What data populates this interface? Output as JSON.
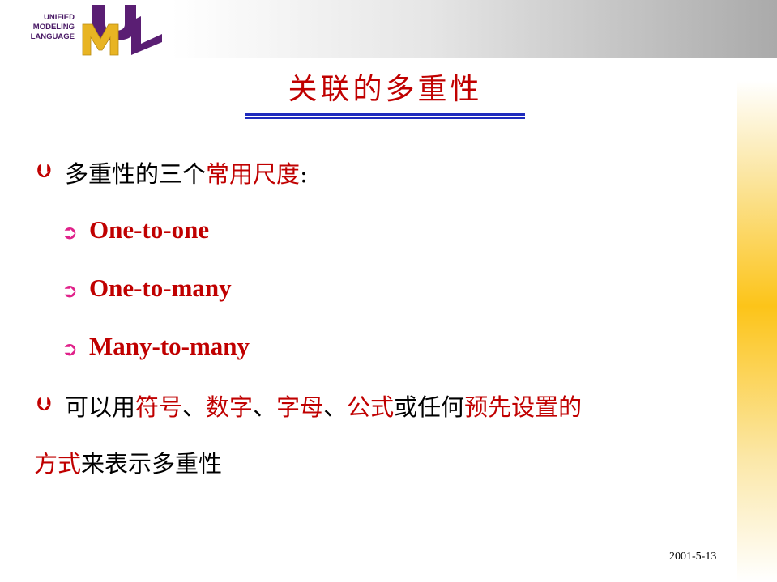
{
  "logo": {
    "line1": "UNIFIED",
    "line2": "MODELING",
    "line3": "LANGUAGE",
    "colors": {
      "u": "#5a1e73",
      "m": "#e8b423",
      "l": "#5a1e73"
    }
  },
  "title": "关联的多重性",
  "bullets": [
    {
      "parts": [
        "多重性的三个",
        "常用尺度",
        ":"
      ],
      "sub": [
        "One-to-one",
        "One-to-many",
        "Many-to-many"
      ]
    },
    {
      "line1": [
        "可以用",
        "符号",
        "、",
        "数字",
        "、",
        "字母",
        "、",
        "公式",
        "或任何",
        "预先设置的"
      ],
      "line2": [
        "方式",
        "来表示多重性"
      ]
    }
  ],
  "footer": {
    "date": "2001-5-13"
  },
  "colors": {
    "accent_red": "#c00000",
    "rule_blue": "#1f2bbd",
    "sub_bullet": "#e0218a"
  }
}
